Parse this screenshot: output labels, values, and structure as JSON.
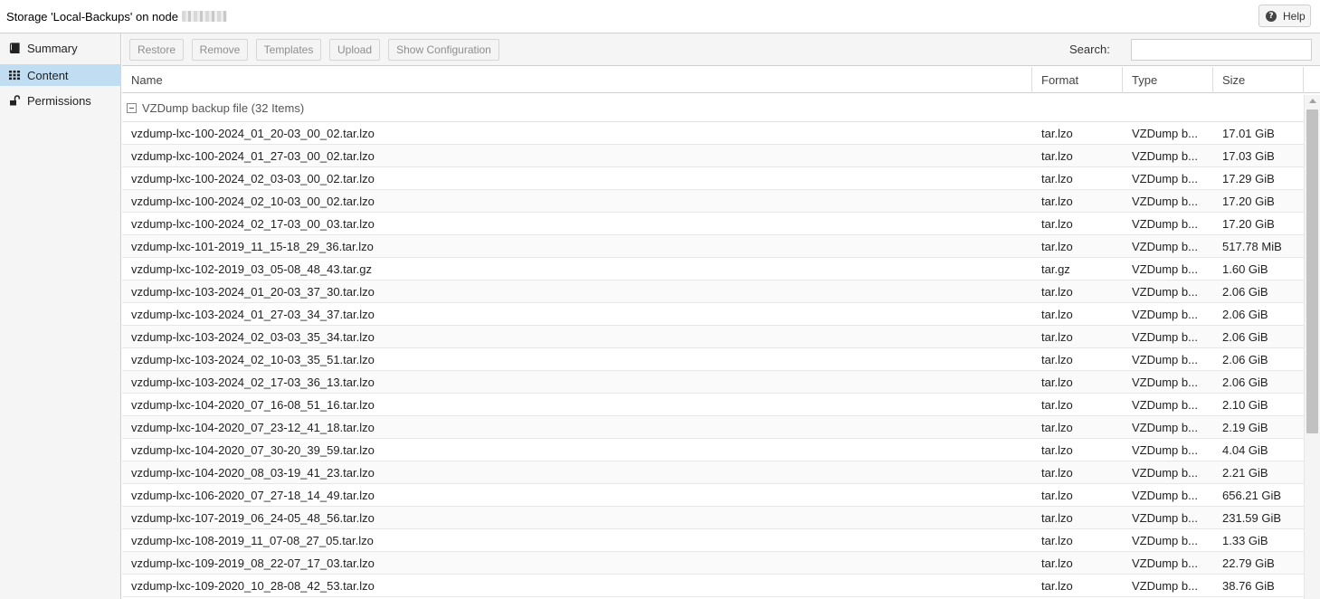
{
  "header": {
    "title": "Storage 'Local-Backups' on node",
    "help_label": "Help"
  },
  "sidebar": {
    "items": [
      {
        "label": "Summary",
        "icon": "book-icon"
      },
      {
        "label": "Content",
        "icon": "grid-icon"
      },
      {
        "label": "Permissions",
        "icon": "unlock-icon"
      }
    ],
    "selected": "Content"
  },
  "toolbar": {
    "restore_label": "Restore",
    "remove_label": "Remove",
    "templates_label": "Templates",
    "upload_label": "Upload",
    "show_config_label": "Show Configuration",
    "search_label": "Search:",
    "search_value": ""
  },
  "grid": {
    "columns": [
      "Name",
      "Format",
      "Type",
      "Size"
    ],
    "group_label": "VZDump backup file (32 Items)",
    "rows": [
      {
        "name": "vzdump-lxc-100-2024_01_20-03_00_02.tar.lzo",
        "format": "tar.lzo",
        "type": "VZDump b...",
        "size": "17.01 GiB"
      },
      {
        "name": "vzdump-lxc-100-2024_01_27-03_00_02.tar.lzo",
        "format": "tar.lzo",
        "type": "VZDump b...",
        "size": "17.03 GiB"
      },
      {
        "name": "vzdump-lxc-100-2024_02_03-03_00_02.tar.lzo",
        "format": "tar.lzo",
        "type": "VZDump b...",
        "size": "17.29 GiB"
      },
      {
        "name": "vzdump-lxc-100-2024_02_10-03_00_02.tar.lzo",
        "format": "tar.lzo",
        "type": "VZDump b...",
        "size": "17.20 GiB"
      },
      {
        "name": "vzdump-lxc-100-2024_02_17-03_00_03.tar.lzo",
        "format": "tar.lzo",
        "type": "VZDump b...",
        "size": "17.20 GiB"
      },
      {
        "name": "vzdump-lxc-101-2019_11_15-18_29_36.tar.lzo",
        "format": "tar.lzo",
        "type": "VZDump b...",
        "size": "517.78 MiB"
      },
      {
        "name": "vzdump-lxc-102-2019_03_05-08_48_43.tar.gz",
        "format": "tar.gz",
        "type": "VZDump b...",
        "size": "1.60 GiB"
      },
      {
        "name": "vzdump-lxc-103-2024_01_20-03_37_30.tar.lzo",
        "format": "tar.lzo",
        "type": "VZDump b...",
        "size": "2.06 GiB"
      },
      {
        "name": "vzdump-lxc-103-2024_01_27-03_34_37.tar.lzo",
        "format": "tar.lzo",
        "type": "VZDump b...",
        "size": "2.06 GiB"
      },
      {
        "name": "vzdump-lxc-103-2024_02_03-03_35_34.tar.lzo",
        "format": "tar.lzo",
        "type": "VZDump b...",
        "size": "2.06 GiB"
      },
      {
        "name": "vzdump-lxc-103-2024_02_10-03_35_51.tar.lzo",
        "format": "tar.lzo",
        "type": "VZDump b...",
        "size": "2.06 GiB"
      },
      {
        "name": "vzdump-lxc-103-2024_02_17-03_36_13.tar.lzo",
        "format": "tar.lzo",
        "type": "VZDump b...",
        "size": "2.06 GiB"
      },
      {
        "name": "vzdump-lxc-104-2020_07_16-08_51_16.tar.lzo",
        "format": "tar.lzo",
        "type": "VZDump b...",
        "size": "2.10 GiB"
      },
      {
        "name": "vzdump-lxc-104-2020_07_23-12_41_18.tar.lzo",
        "format": "tar.lzo",
        "type": "VZDump b...",
        "size": "2.19 GiB"
      },
      {
        "name": "vzdump-lxc-104-2020_07_30-20_39_59.tar.lzo",
        "format": "tar.lzo",
        "type": "VZDump b...",
        "size": "4.04 GiB"
      },
      {
        "name": "vzdump-lxc-104-2020_08_03-19_41_23.tar.lzo",
        "format": "tar.lzo",
        "type": "VZDump b...",
        "size": "2.21 GiB"
      },
      {
        "name": "vzdump-lxc-106-2020_07_27-18_14_49.tar.lzo",
        "format": "tar.lzo",
        "type": "VZDump b...",
        "size": "656.21 GiB"
      },
      {
        "name": "vzdump-lxc-107-2019_06_24-05_48_56.tar.lzo",
        "format": "tar.lzo",
        "type": "VZDump b...",
        "size": "231.59 GiB"
      },
      {
        "name": "vzdump-lxc-108-2019_11_07-08_27_05.tar.lzo",
        "format": "tar.lzo",
        "type": "VZDump b...",
        "size": "1.33 GiB"
      },
      {
        "name": "vzdump-lxc-109-2019_08_22-07_17_03.tar.lzo",
        "format": "tar.lzo",
        "type": "VZDump b...",
        "size": "22.79 GiB"
      },
      {
        "name": "vzdump-lxc-109-2020_10_28-08_42_53.tar.lzo",
        "format": "tar.lzo",
        "type": "VZDump b...",
        "size": "38.76 GiB"
      }
    ]
  },
  "colors": {
    "selected_nav": "#c1ddf1",
    "panel_bg": "#f5f5f5",
    "disabled_text": "#8e8e8e"
  }
}
